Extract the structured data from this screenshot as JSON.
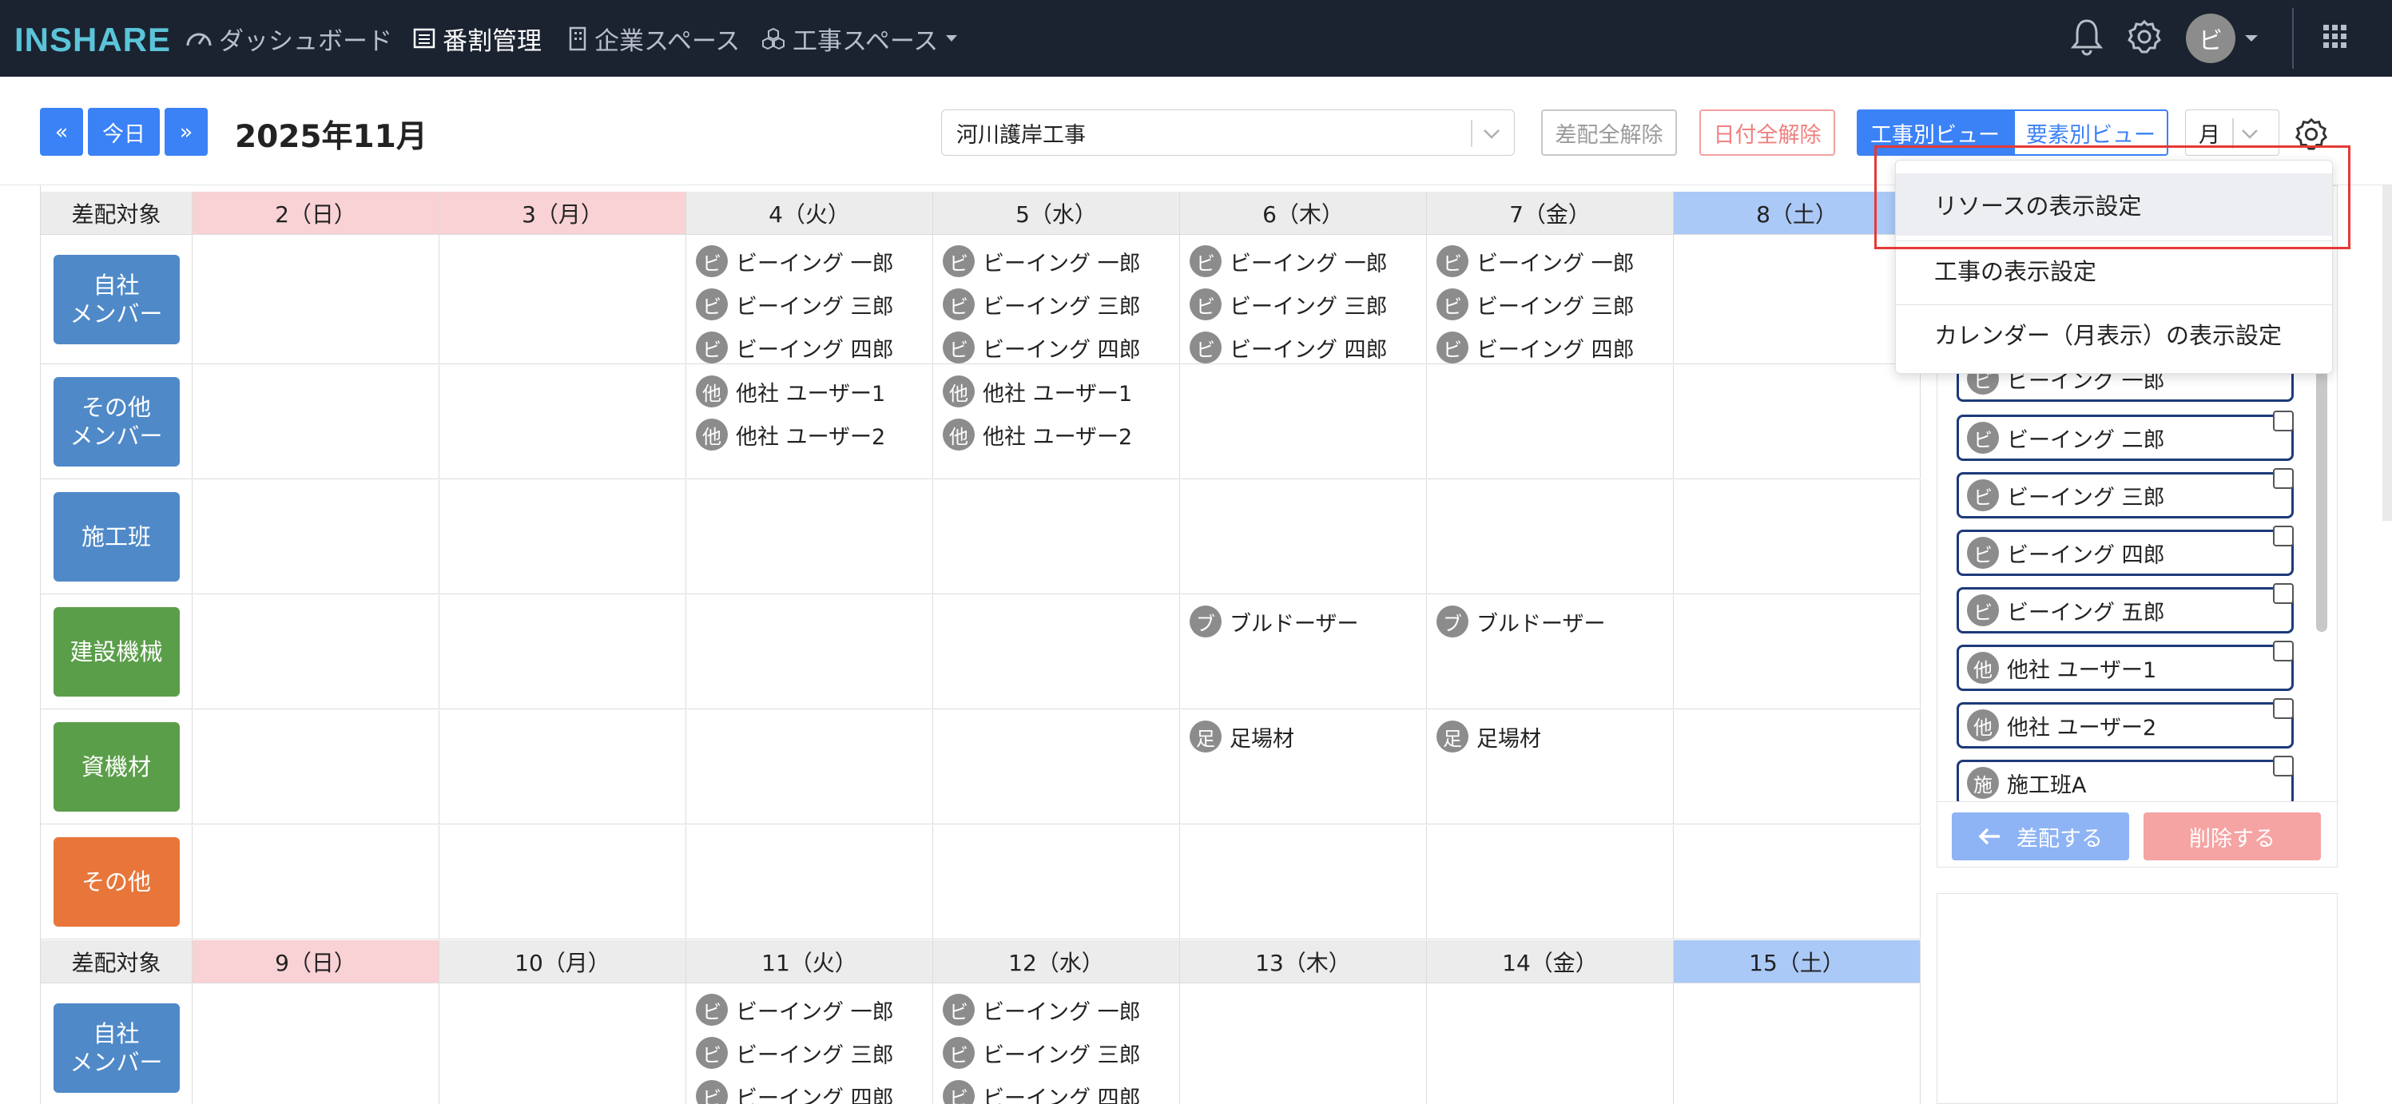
{
  "nav": {
    "logo": "INSHARE",
    "items": [
      {
        "label": "ダッシュボード"
      },
      {
        "label": "番割管理"
      },
      {
        "label": "企業スペース"
      },
      {
        "label": "工事スペース"
      }
    ],
    "avatar_initial": "ビ"
  },
  "toolbar": {
    "prev_label": "«",
    "today_label": "今日",
    "next_label": "»",
    "month_title": "2025年11月",
    "project_value": "河川護岸工事",
    "clear_dispatch_label": "差配全解除",
    "clear_date_label": "日付全解除",
    "view_by_project_label": "工事別ビュー",
    "view_by_element_label": "要素別ビュー",
    "period_value": "月"
  },
  "calendar": {
    "label_header": "差配対象",
    "week1_days": [
      "2（日）",
      "3（月）",
      "4（火）",
      "5（水）",
      "6（木）",
      "7（金）",
      "8（土）"
    ],
    "week2_days": [
      "9（日）",
      "10（月）",
      "11（火）",
      "12（水）",
      "13（木）",
      "14（金）",
      "15（土）"
    ],
    "rows": [
      {
        "label": "自社\nメンバー"
      },
      {
        "label": "その他\nメンバー"
      },
      {
        "label": "施工班"
      },
      {
        "label": "建設機械"
      },
      {
        "label": "資機材"
      },
      {
        "label": "その他"
      }
    ],
    "chips": {
      "bi_icon": "ビ",
      "other_icon": "他",
      "bull_icon": "ブ",
      "scaf_icon": "足",
      "ichiro": "ビーイング 一郎",
      "saburo": "ビーイング 三郎",
      "shiro": "ビーイング 四郎",
      "user1": "他社 ユーザー1",
      "user2": "他社 ユーザー2",
      "bulldozer": "ブルドーザー",
      "scaffold": "足場材"
    }
  },
  "side_panel": {
    "items": [
      {
        "icon": "ビ",
        "label": "ビーイング 一郎"
      },
      {
        "icon": "ビ",
        "label": "ビーイング 二郎"
      },
      {
        "icon": "ビ",
        "label": "ビーイング 三郎"
      },
      {
        "icon": "ビ",
        "label": "ビーイング 四郎"
      },
      {
        "icon": "ビ",
        "label": "ビーイング 五郎"
      },
      {
        "icon": "他",
        "label": "他社 ユーザー1"
      },
      {
        "icon": "他",
        "label": "他社 ユーザー2"
      },
      {
        "icon": "施",
        "label": "施工班A"
      }
    ],
    "dispatch_label": "差配する",
    "delete_label": "削除する"
  },
  "settings_menu": {
    "items": [
      {
        "label": "リソースの表示設定"
      },
      {
        "label": "工事の表示設定"
      },
      {
        "label": "カレンダー（月表示）の表示設定"
      }
    ]
  },
  "colors": {
    "navbar": "#1b2330",
    "accent_blue": "#3b82f6",
    "danger": "#f08080",
    "highlight_box": "#e53935"
  }
}
